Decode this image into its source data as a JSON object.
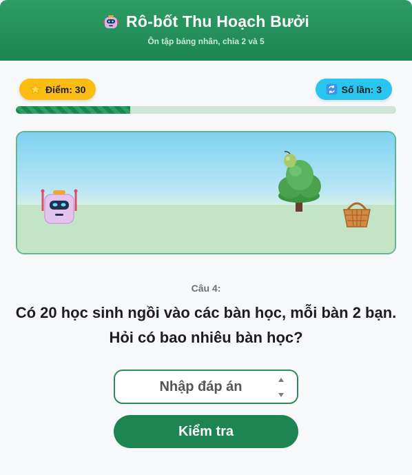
{
  "header": {
    "icon": "robot-icon",
    "title": "Rô-bốt Thu Hoạch Bưởi",
    "subtitle": "Ôn tập bảng nhân, chia 2 và 5"
  },
  "status": {
    "score_icon": "star-icon",
    "score_label": "Điểm: 30",
    "tries_icon": "refresh-icon",
    "tries_label": "Số lần: 3",
    "progress": 0.3
  },
  "scene": {
    "robot_icon": "robot-icon",
    "tree_icon": "pomelo-tree-icon",
    "fruit_icon": "pomelo-icon",
    "basket_icon": "basket-icon"
  },
  "quiz": {
    "question_label": "Câu 4:",
    "question_text": "Có 20 học sinh ngồi vào các bàn học, mỗi bàn 2 bạn. Hỏi có bao nhiêu bàn học?",
    "answer_placeholder": "Nhập đáp án",
    "answer_value": "",
    "check_button": "Kiểm tra"
  },
  "colors": {
    "brand": "#1c8552",
    "score_badge": "#fbbd14",
    "tries_badge": "#28c5ef"
  }
}
